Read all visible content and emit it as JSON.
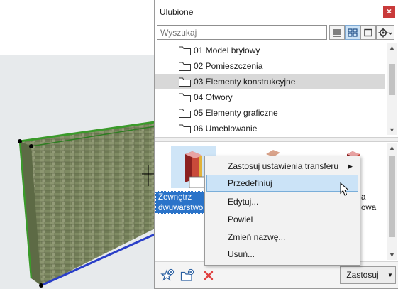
{
  "panel": {
    "title": "Ulubione",
    "close_glyph": "×",
    "search_placeholder": "Wyszukaj"
  },
  "tree": {
    "items": [
      {
        "label": "01 Model bryłowy"
      },
      {
        "label": "02 Pomieszczenia"
      },
      {
        "label": "03 Elementy konstrukcyjne"
      },
      {
        "label": "04 Otwory"
      },
      {
        "label": "05 Elementy graficzne"
      },
      {
        "label": "06 Umeblowanie"
      }
    ],
    "selected_index": 2
  },
  "thumbs": {
    "selected_label_line1": "Zewnętrz",
    "selected_label_line2": "dwuwarstwo",
    "right_label_line1": "a",
    "right_label_line2": "owa"
  },
  "context_menu": {
    "items": [
      {
        "label": "Zastosuj ustawienia transferu",
        "submenu_glyph": "▶"
      },
      {
        "label": "Przedefiniuj"
      },
      {
        "label": "Edytuj..."
      },
      {
        "label": "Powiel"
      },
      {
        "label": "Zmień nazwę..."
      },
      {
        "label": "Usuń..."
      }
    ],
    "highlighted_index": 1
  },
  "footer": {
    "apply_label": "Zastosuj",
    "apply_drop_glyph": "▼"
  },
  "colors": {
    "accent": "#2a73c9",
    "highlight": "#cbe3f7",
    "delete": "#e04040",
    "wall_edge": "#3a9a2a"
  }
}
